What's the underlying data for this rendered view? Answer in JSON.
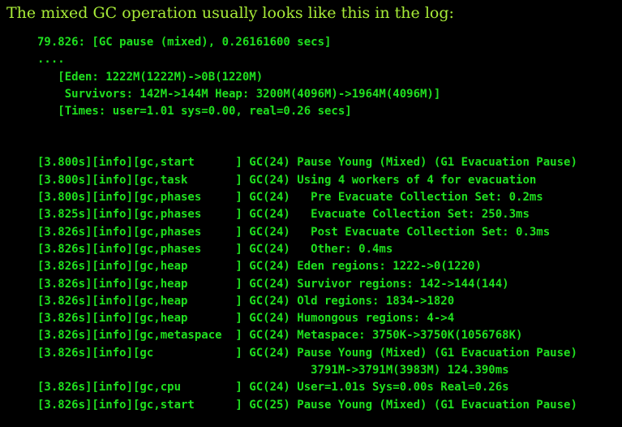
{
  "heading": "The mixed GC operation usually looks like this in the log:",
  "old_log": [
    "79.826: [GC pause (mixed), 0.26161600 secs]",
    "....",
    "   [Eden: 1222M(1222M)->0B(1220M)",
    "    Survivors: 142M->144M Heap: 3200M(4096M)->1964M(4096M)]",
    "   [Times: user=1.01 sys=0.00, real=0.26 secs]"
  ],
  "new_log": [
    "[3.800s][info][gc,start      ] GC(24) Pause Young (Mixed) (G1 Evacuation Pause)",
    "[3.800s][info][gc,task       ] GC(24) Using 4 workers of 4 for evacuation",
    "[3.800s][info][gc,phases     ] GC(24)   Pre Evacuate Collection Set: 0.2ms",
    "[3.825s][info][gc,phases     ] GC(24)   Evacuate Collection Set: 250.3ms",
    "[3.826s][info][gc,phases     ] GC(24)   Post Evacuate Collection Set: 0.3ms",
    "[3.826s][info][gc,phases     ] GC(24)   Other: 0.4ms",
    "[3.826s][info][gc,heap       ] GC(24) Eden regions: 1222->0(1220)",
    "[3.826s][info][gc,heap       ] GC(24) Survivor regions: 142->144(144)",
    "[3.826s][info][gc,heap       ] GC(24) Old regions: 1834->1820",
    "[3.826s][info][gc,heap       ] GC(24) Humongous regions: 4->4",
    "[3.826s][info][gc,metaspace  ] GC(24) Metaspace: 3750K->3750K(1056768K)",
    "[3.826s][info][gc            ] GC(24) Pause Young (Mixed) (G1 Evacuation Pause)",
    "                                        3791M->3791M(3983M) 124.390ms",
    "[3.826s][info][gc,cpu        ] GC(24) User=1.01s Sys=0.00s Real=0.26s",
    "[3.826s][info][gc,start      ] GC(25) Pause Young (Mixed) (G1 Evacuation Pause)"
  ],
  "colors": {
    "background": "#000000",
    "heading_text": "#a8ec38",
    "code_text": "#1fe01f"
  }
}
